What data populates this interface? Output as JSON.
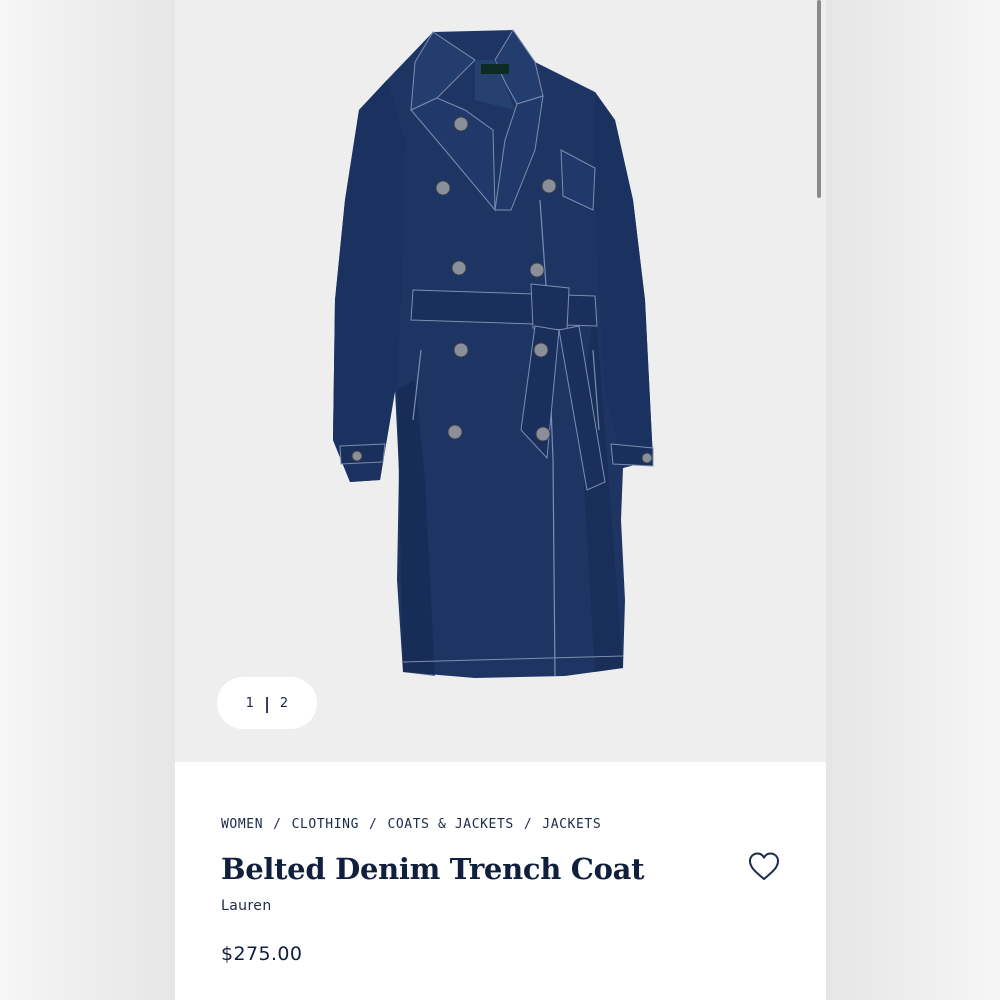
{
  "gallery": {
    "current_page": "1",
    "total_pages": "2",
    "separator": "|",
    "product_image": "denim-trench-coat-image"
  },
  "breadcrumb": {
    "items": [
      "WOMEN",
      "CLOTHING",
      "COATS & JACKETS",
      "JACKETS"
    ],
    "separator": "/"
  },
  "product": {
    "title": "Belted Denim Trench Coat",
    "brand": "Lauren",
    "price": "$275.00",
    "coat_label": "LAUREN"
  },
  "icons": {
    "wishlist": "heart-outline-icon"
  },
  "colors": {
    "denim": "#1e3564",
    "denim_dark": "#152850",
    "text_navy": "#0f1f3d",
    "image_background": "#eeeeee"
  }
}
